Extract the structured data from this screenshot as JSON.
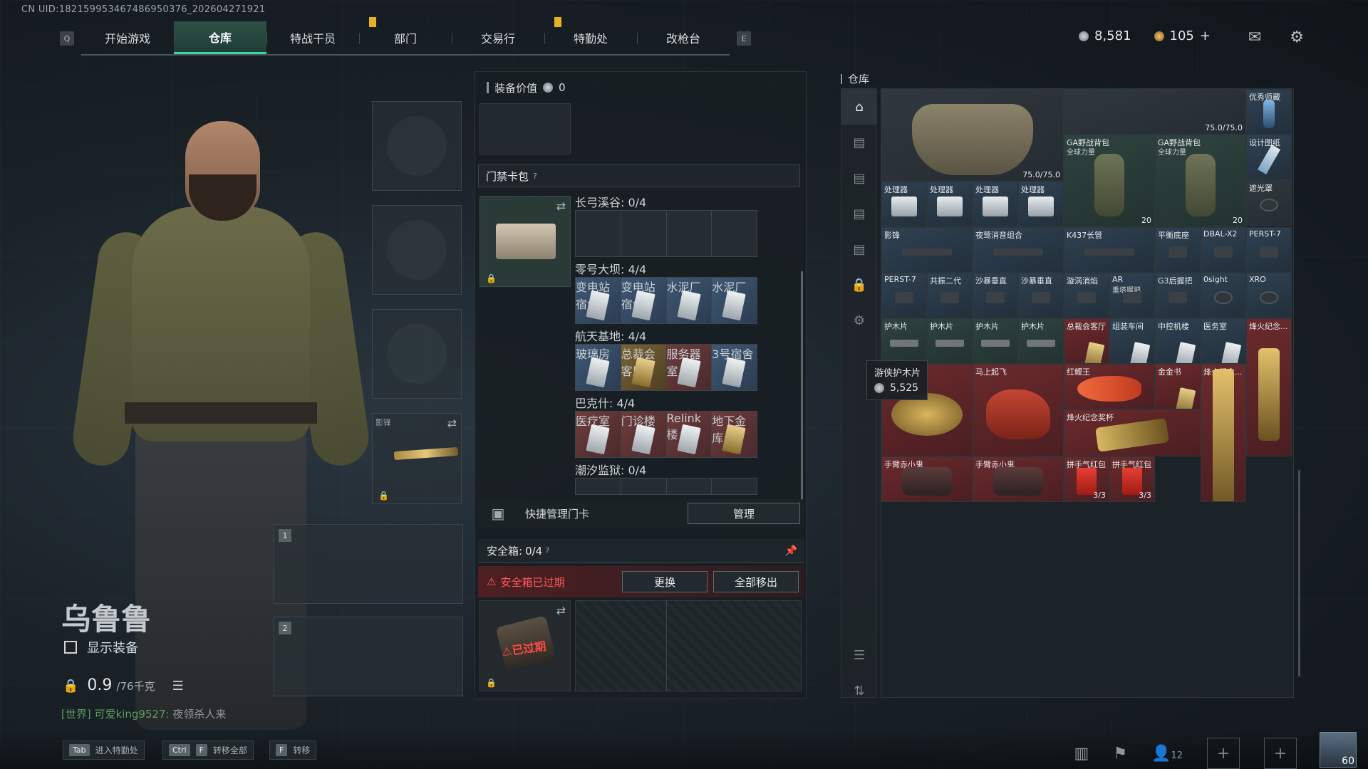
{
  "uid_text": "CN UID:182159953467486950376_202604271921",
  "nav": {
    "left_key": "Q",
    "right_key": "E",
    "tabs": [
      "开始游戏",
      "仓库",
      "特战干员",
      "部门",
      "交易行",
      "特勤处",
      "改枪台"
    ],
    "active_tab": "仓库"
  },
  "currency": {
    "silver": "8,581",
    "gold": "105",
    "gold_add": "+"
  },
  "icons": {
    "mail": "mail-icon",
    "settings": "gear-icon"
  },
  "player": {
    "name": "乌鲁鲁",
    "show_equipment_label": "显示装备",
    "weight_current": "0.9",
    "weight_max": "/76千克",
    "chat_channel": "[世界]",
    "chat_user": "可爱king9527:",
    "chat_message": "夜领杀人来"
  },
  "equip_slots": {
    "weapon_name": "影锋",
    "slot1": "1",
    "slot2": "2"
  },
  "middle": {
    "equipment_value_label": "装备价值",
    "equipment_value": "0",
    "card_pack_label": "门禁卡包",
    "help": "?",
    "zones": [
      {
        "label": "长弓溪谷: 0/4",
        "cards": []
      },
      {
        "label": "零号大坝: 4/4",
        "cards": [
          "变电站宿舍",
          "变电站宿舍",
          "水泥厂",
          "水泥厂"
        ]
      },
      {
        "label": "航天基地: 4/4",
        "cards": [
          "玻璃房",
          "总裁会客厅",
          "服务器室",
          "3号宿舍"
        ]
      },
      {
        "label": "巴克什: 4/4",
        "cards": [
          "医疗室",
          "门诊楼",
          "Relink楼",
          "地下金库"
        ]
      },
      {
        "label": "潮汐监狱: 0/4",
        "cards": []
      }
    ],
    "quick_manage_label": "快捷管理门卡",
    "manage_button": "管理",
    "safe_box_label": "安全箱:",
    "safe_box_value": "0/4",
    "safe_expired_text": "安全箱已过期",
    "replace_button": "更换",
    "move_all_button": "全部移出",
    "expired_stamp": "已过期"
  },
  "warehouse": {
    "title": "仓库",
    "items": {
      "armor_durability": "75.0/75.0",
      "bag1_name": "GA野战背包",
      "bag1_sub": "全球力量",
      "bag2_name": "GA野战背包",
      "bag2_sub": "全球力量",
      "bag_durability": "75.0/75.0",
      "bag_count": "20",
      "top_right_1": "优秀师藏",
      "top_right_2": "设计图纸",
      "top_right_3": "遮光罩",
      "processor": "处理器",
      "guns": [
        "影锋",
        "夜莺消音组合",
        "K437长管",
        "平衡底座",
        "DBAL-X2",
        "PERST-7"
      ],
      "parts": [
        "PERST-7",
        "共振二代",
        "沙暴垂直",
        "沙暴垂直",
        "漩涡消焰",
        "AR",
        "G3后握把",
        "0sight",
        "XRO"
      ],
      "part_sub": "重塔握把",
      "plate": "护木片",
      "cards_row": [
        "总裁会客厅",
        "组装车间",
        "中控机楼",
        "医务室"
      ],
      "fire_memorial": "烽火纪念...",
      "horse": "马上起飞",
      "fish": "红鲤王",
      "gold_card": "金金书",
      "relic": "烽火纪念奖杯",
      "doll": "手臂赤小鬼",
      "envelope": "拼手气红包",
      "envelope_count": "3/3"
    },
    "tooltip_name": "游侠护木片",
    "tooltip_value": "5,525"
  },
  "bottom": {
    "hint1_key": "Tab",
    "hint1_text": "进入特勤处",
    "hint2_key1": "Ctrl",
    "hint2_key2": "F",
    "hint2_text": "转移全部",
    "hint3_key": "F",
    "hint3_text": "转移",
    "friend_count": "12",
    "level": "60"
  },
  "colors": {
    "accent_green": "#3fd59b",
    "alert_red": "#ff5a55",
    "flag_yellow": "#e6b21f"
  }
}
